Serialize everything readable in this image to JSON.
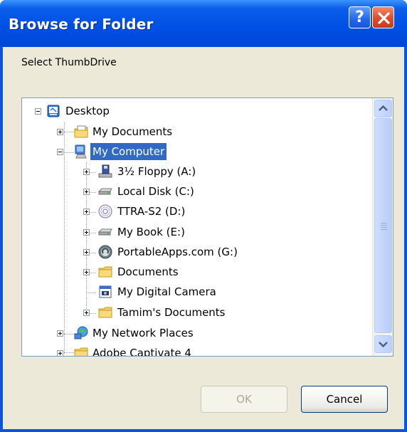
{
  "window": {
    "title": "Browse for Folder",
    "help_label": "?"
  },
  "dialog": {
    "prompt": "Select ThumbDrive"
  },
  "tree": {
    "items": [
      {
        "label": "Desktop",
        "icon": "desktop-icon"
      },
      {
        "label": "My Documents",
        "icon": "documents-folder-icon"
      },
      {
        "label": "My Computer",
        "icon": "computer-icon",
        "selected": true
      },
      {
        "label": "3½ Floppy (A:)",
        "icon": "floppy-drive-icon"
      },
      {
        "label": "Local Disk (C:)",
        "icon": "hard-disk-icon"
      },
      {
        "label": "TTRA-S2 (D:)",
        "icon": "cd-drive-icon"
      },
      {
        "label": "My Book (E:)",
        "icon": "hard-disk-icon"
      },
      {
        "label": "PortableApps.com (G:)",
        "icon": "portableapps-drive-icon"
      },
      {
        "label": "Documents",
        "icon": "folder-icon"
      },
      {
        "label": "My Digital Camera",
        "icon": "camera-icon"
      },
      {
        "label": "Tamim's Documents",
        "icon": "folder-icon"
      },
      {
        "label": "My Network Places",
        "icon": "network-icon"
      },
      {
        "label": "Adobe Captivate 4",
        "icon": "folder-icon"
      }
    ]
  },
  "buttons": {
    "ok_label": "OK",
    "cancel_label": "Cancel"
  },
  "colors": {
    "titlebar": "#0054e3",
    "selection": "#316ac5",
    "dialog_bg": "#ece9d8"
  }
}
